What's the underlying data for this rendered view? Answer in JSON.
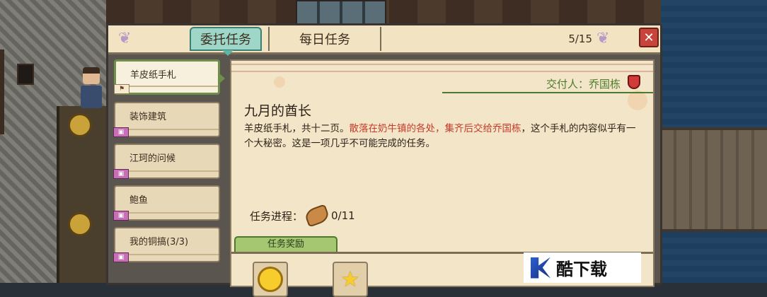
{
  "header": {
    "tabs": [
      {
        "label": "委托任务",
        "active": true
      },
      {
        "label": "每日任务",
        "active": false
      }
    ],
    "page_indicator": "5/15",
    "close_icon": "close-icon"
  },
  "sidebar": {
    "items": [
      {
        "label": "羊皮纸手札",
        "active": true,
        "badge": "flag-icon"
      },
      {
        "label": "装饰建筑",
        "active": false,
        "badge": "gift-icon"
      },
      {
        "label": "江珂的问候",
        "active": false,
        "badge": "gift-icon"
      },
      {
        "label": "鲍鱼",
        "active": false,
        "badge": "gift-icon"
      },
      {
        "label": "我的铜搞(3/3)",
        "active": false,
        "badge": "gift-icon"
      }
    ]
  },
  "task": {
    "giver": "交付人：乔国栋",
    "title": "九月的酋长",
    "desc_part1": "羊皮纸手札，共十二页。",
    "desc_hl1": "散落在奶牛镇的各处",
    "desc_sep": "，",
    "desc_hl2": "集齐后交给乔国栋",
    "desc_part2": "，这个手札的内容似乎有一个大秘密。这是一项几乎不可能完成的任务。",
    "progress_label": "任务进程：",
    "progress_value": "0/11",
    "progress_icon": "bread-icon"
  },
  "rewards": {
    "tab_label": "任务奖励",
    "items": [
      "coin-icon",
      "star-icon"
    ]
  },
  "watermark": {
    "text": "酷下载"
  },
  "colors": {
    "accent_teal": "#9ed6c8",
    "highlight_red": "#c43a2a",
    "giver_green": "#4d7a2c",
    "panel_bg": "#f3e6c8"
  }
}
